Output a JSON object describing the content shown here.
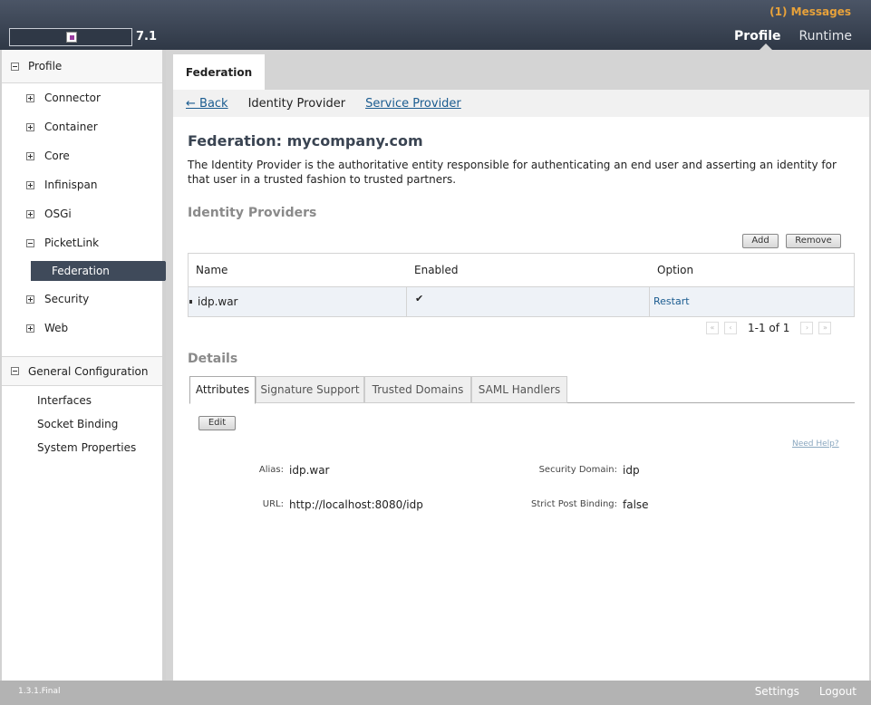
{
  "header": {
    "version": "7.1",
    "messages": "(1) Messages",
    "nav": [
      "Profile",
      "Runtime"
    ]
  },
  "sidebar": {
    "profile_label": "Profile",
    "items": [
      "Connector",
      "Container",
      "Core",
      "Infinispan",
      "OSGi",
      "PicketLink",
      "Security",
      "Web"
    ],
    "selected_subitem": "Federation",
    "general_config_label": "General Configuration",
    "general_items": [
      "Interfaces",
      "Socket Binding",
      "System Properties"
    ]
  },
  "main": {
    "top_tab": "Federation",
    "subnav": {
      "back": "← Back",
      "identity_provider": "Identity Provider",
      "service_provider": "Service Provider"
    },
    "title": "Federation: mycompany.com",
    "description": "The Identity Provider is the authoritative entity responsible for authenticating an end user and asserting an identity for that user in a trusted fashion to trusted partners.",
    "identity_providers_title": "Identity Providers",
    "add_label": "Add",
    "remove_label": "Remove",
    "table": {
      "headers": [
        "Name",
        "Enabled",
        "Option"
      ],
      "rows": [
        {
          "name": "idp.war",
          "enabled": "✔",
          "option": "Restart"
        }
      ]
    },
    "pager_text": "1-1 of 1",
    "details_title": "Details",
    "detail_tabs": [
      "Attributes",
      "Signature Support",
      "Trusted Domains",
      "SAML Handlers"
    ],
    "edit_label": "Edit",
    "need_help": "Need Help?",
    "fields": {
      "alias_label": "Alias:",
      "alias_value": "idp.war",
      "url_label": "URL:",
      "url_value": "http://localhost:8080/idp",
      "security_domain_label": "Security Domain:",
      "security_domain_value": "idp",
      "strict_post_label": "Strict Post Binding:",
      "strict_post_value": "false"
    }
  },
  "footer": {
    "build": "1.3.1.Final",
    "settings": "Settings",
    "logout": "Logout"
  },
  "colors": {
    "header_dark": "#2f3846",
    "messages_accent": "#e8a23a",
    "selected_item": "#3f4a5a",
    "link": "#1b5c90"
  }
}
